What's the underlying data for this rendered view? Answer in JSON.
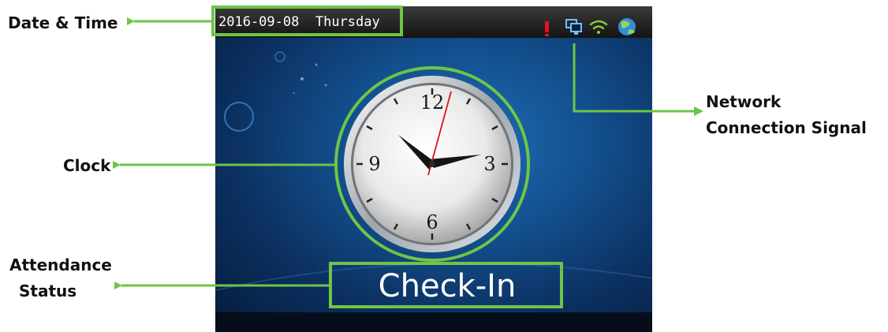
{
  "callouts": {
    "date_time": "Date & Time",
    "clock": "Clock",
    "attendance": [
      "Attendance",
      "Status"
    ],
    "network": [
      "Network",
      "Connection Signal"
    ]
  },
  "device_screen": {
    "date": "2016-09-08",
    "weekday": "Thursday",
    "attendance_status": "Check-In",
    "clock_numerals": [
      "12",
      "3",
      "6",
      "9"
    ],
    "status_icons": [
      "alert-icon",
      "network-connection-icon",
      "wifi-signal-icon",
      "globe-icon"
    ]
  },
  "colors": {
    "callout_arrow": "#6ec546",
    "screen_bg": "#134f8e"
  }
}
